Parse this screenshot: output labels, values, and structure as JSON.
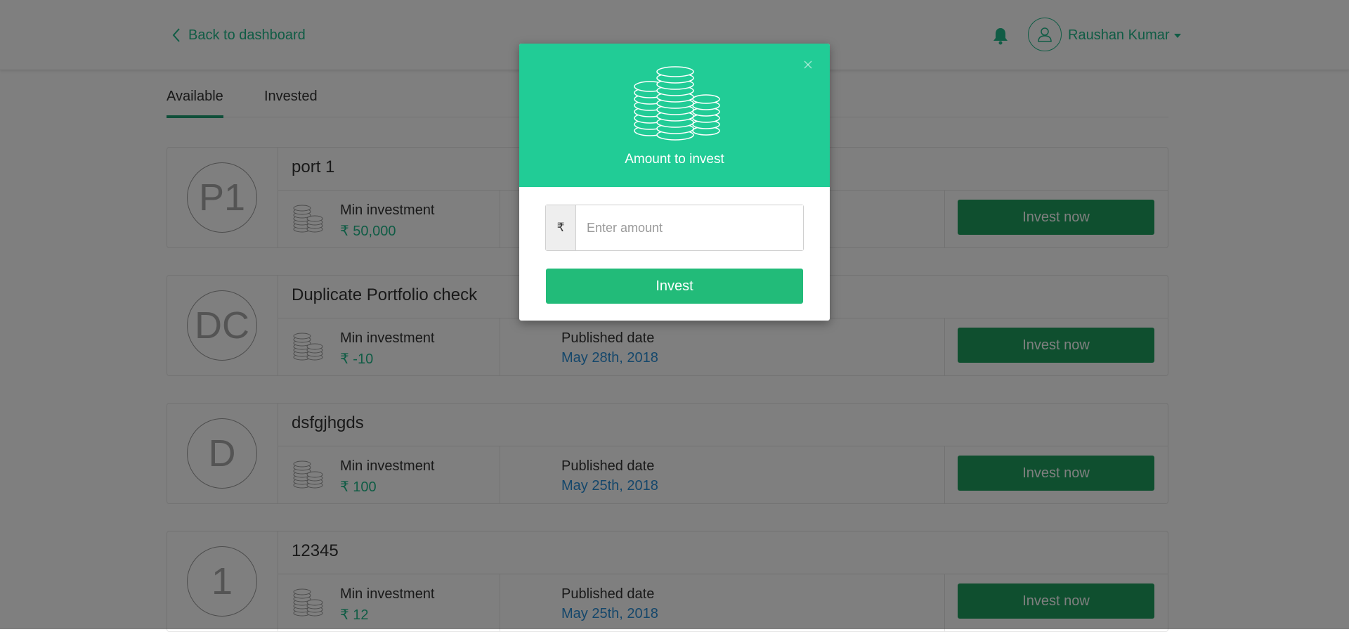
{
  "header": {
    "back_label": "Back to dashboard",
    "user_name": "Raushan Kumar"
  },
  "tabs": [
    {
      "label": "Available",
      "active": true
    },
    {
      "label": "Invested",
      "active": false
    }
  ],
  "cards": [
    {
      "initials": "P1",
      "title": "port 1",
      "min_label": "Min investment",
      "min_value": "₹ 50,000",
      "pub_label": "",
      "pub_value": "",
      "button": "Invest now"
    },
    {
      "initials": "DC",
      "title": "Duplicate Portfolio check",
      "min_label": "Min investment",
      "min_value": "₹ -10",
      "pub_label": "Published date",
      "pub_value": "May 28th, 2018",
      "button": "Invest now"
    },
    {
      "initials": "D",
      "title": "dsfgjhgds",
      "min_label": "Min investment",
      "min_value": "₹ 100",
      "pub_label": "Published date",
      "pub_value": "May 25th, 2018",
      "button": "Invest now"
    },
    {
      "initials": "1",
      "title": "12345",
      "min_label": "Min investment",
      "min_value": "₹ 12",
      "pub_label": "Published date",
      "pub_value": "May 25th, 2018",
      "button": "Invest now"
    }
  ],
  "modal": {
    "title": "Amount to invest",
    "currency_symbol": "₹",
    "amount_placeholder": "Enter amount",
    "amount_value": "",
    "invest_label": "Invest"
  },
  "colors": {
    "accent": "#21b98a",
    "modal_header": "#21cc96",
    "card_button": "#1e9f5e",
    "modal_button": "#22bb79",
    "date_text": "#2b8fd6"
  },
  "icons": {
    "back": "chevron-left-icon",
    "notifications": "bell-icon",
    "user": "user-icon",
    "coins": "coins-stack-icon",
    "close": "close-icon"
  }
}
